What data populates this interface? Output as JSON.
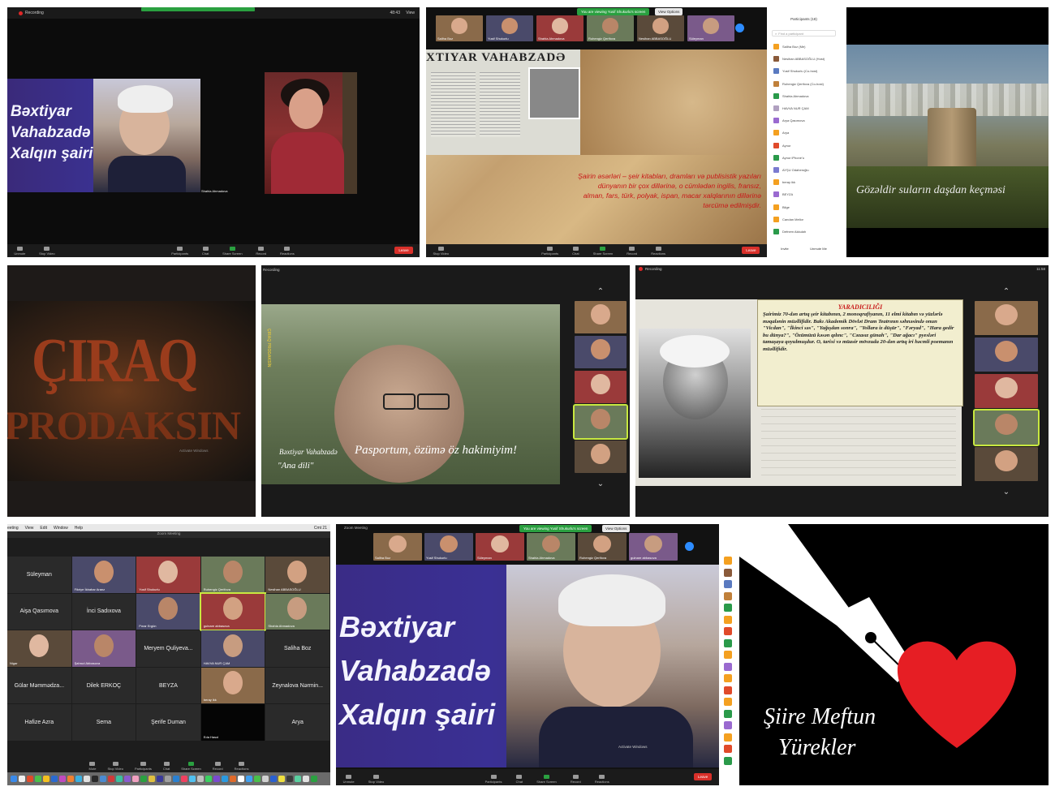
{
  "p1": {
    "recording": "Recording",
    "top_time": "48:43",
    "top_view": "View",
    "title_lines": [
      "Bəxtiyar",
      "Vahabzadə",
      "Xalqın şairi"
    ],
    "speaker": "Shahla Ahmadova",
    "toolbar": [
      "Unmute",
      "Stop Video",
      "Participants",
      "Chat",
      "Share Screen",
      "Record",
      "Reactions"
    ],
    "leave": "Leave"
  },
  "p2": {
    "viewing": "You are viewing Yusif Shukurlu's screen",
    "view_options": "View Options",
    "thumbs": [
      "Saliha Boz",
      "Yusif Shukurlu",
      "Shahla Ahmadova",
      "Ruhengiz Qerifova",
      "Nesihan ABBASOĞLU",
      "Süleyman"
    ],
    "poster": "XTIYAR VAHABZADƏ",
    "caption": "Şairin əsərləri – şeir kitabları, dramları və publisistik yazıları dünyanın bir çox dillərinə, o cümlədən ingilis, fransız, alman, fars, türk, polyak, ispan, macar xalqlarının dillərinə tərcümə edilmişdir.",
    "participants_title": "Participants (18)",
    "find": "Find a participant",
    "participants": [
      "Saliha Boz (Me)",
      "Nesihan ABBASOĞLU (Host)",
      "Yusif Shukurlu (Co-host)",
      "Ruhengiz Qerifova (Co-host)",
      "Shahla Ahmadova",
      "HAVVA NUR ÇAM",
      "Arya Qasımova",
      "Arya",
      "Aynur",
      "Aynur iPhone'u",
      "AYŞU Odaheroğlu",
      "beray ikk",
      "BEYZA",
      "Bilge",
      "Candan Mellor",
      "Defnem Akkulah"
    ],
    "invite": "Invite",
    "unmute": "Unmute Me",
    "toolbar": [
      "Stop Video",
      "Participants",
      "Chat",
      "Share Screen",
      "Record",
      "Reactions"
    ],
    "leave": "Leave"
  },
  "p3": {
    "subtitle": "Gözəldir suların daşdan keçməsi"
  },
  "p4": {
    "title_line1": "ÇIRAQ",
    "title_line2": "PRODAKSIN",
    "watermark": "Activate Windows"
  },
  "p5": {
    "recording": "Recording",
    "side_text": "ÇIRAQ PRODAKSİN",
    "name": "Bəxtiyar Vahabzadə",
    "quote": "Pasportum, özümə öz hakimiyim!",
    "work": "\"Ana dili\""
  },
  "p6": {
    "recording": "Recording",
    "time": "11:58",
    "heading": "YARADICILIĞI",
    "body": "Şairimiz 70-dən artıq şeir kitabının, 2 monoqrafiyanın, 11 elmi kitabın və yüzlərlə məqalənin müəllifidir. Bakı Akademik Dövlət Dram Teatrının səhnəsində onun \"Vicdan\", \"İkinci səs\", \"Yağışdan sonra\", \"Yollara iz düşür\", \"Fəryad\", \"Hara gedir bu dünya?\", \"Özümüzü kəsən qılınc\", \"Cəzasız günah\", \"Dar ağacı\" pyesləri tamaşaya qoyulmuşdur. O, tarixi və müasir mövzuda 20-dən artıq iri həcmli poemanın müəllifidir."
  },
  "p7": {
    "menu": [
      "eeting",
      "View",
      "Edit",
      "Window",
      "Help"
    ],
    "clock": "Cmt 21",
    "window_title": "Zoom Meeting",
    "cells": [
      [
        "Süleyman",
        "Fikriye İkbahar Aranz",
        "Yusif Shukurlu",
        "Ruhengiz Qerifova",
        "Nesihan ABBASOĞLU"
      ],
      [
        "Aişa Qasımova",
        "İnci Sadıxova",
        "Pınar Ergün",
        "gulnare abbasova",
        "Shahla Ahmadova"
      ],
      [
        "Nigar",
        "Şahrud Abbasova",
        "Meryem Quliyeva...",
        "HAVVA NUR ÇAM",
        "Saliha Boz"
      ],
      [
        "Gülar Məmmədza...",
        "Dilek ERKOÇ",
        "BEYZA",
        "beray ikk",
        "Zeynalova Nərmin..."
      ],
      [
        "Hafize Azra",
        "Sema",
        "Şerife Duman",
        "Eda Hasol",
        "Arya"
      ]
    ],
    "toolbar": [
      "Mute",
      "Stop Video",
      "Participants",
      "Chat",
      "Share Screen",
      "Record",
      "Reactions"
    ]
  },
  "p8": {
    "window_title": "Zoom Meeting",
    "viewing": "You are viewing Yusif Shukurlu's screen",
    "view_options": "View Options",
    "thumbs": [
      "Saliha Boz",
      "Yusif Shukurlu",
      "Süleyman",
      "Shahla Ahmadova",
      "Ruhengiz Qerifova",
      "gulnare abbasova"
    ],
    "recording": "Recording",
    "title_lines": [
      "Bəxtiyar",
      "Vahabzadə",
      "Xalqın şairi"
    ],
    "watermark": "Activate Windows",
    "toolbar": [
      "Unmute",
      "Stop Video",
      "Participants",
      "Chat",
      "Share Screen",
      "Record",
      "Reactions"
    ],
    "leave": "Leave"
  },
  "p9": {
    "line1": "Şiire Meftun",
    "line2": "Yürekler"
  }
}
